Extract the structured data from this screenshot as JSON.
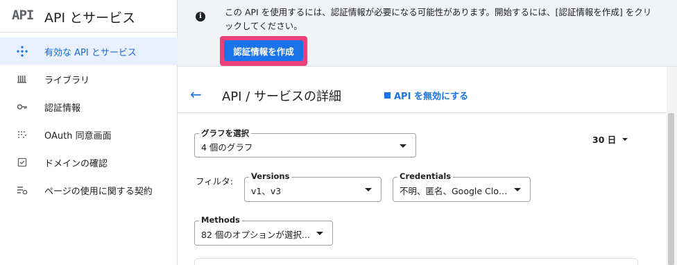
{
  "brand": {
    "logo": "API",
    "title": "API とサービス"
  },
  "sidebar": {
    "items": [
      {
        "label": "有効な API とサービス",
        "icon": "api-diamond-icon",
        "active": true
      },
      {
        "label": "ライブラリ",
        "icon": "library-icon"
      },
      {
        "label": "認証情報",
        "icon": "key-icon"
      },
      {
        "label": "OAuth 同意画面",
        "icon": "consent-icon"
      },
      {
        "label": "ドメインの確認",
        "icon": "checkbox-icon"
      },
      {
        "label": "ページの使用に関する契約",
        "icon": "settings-list-icon"
      }
    ]
  },
  "banner": {
    "info_icon": "i",
    "text": "この API を使用するには、認証情報が必要になる可能性があります。開始するには、[認証情報を作成] をクリックしてください。",
    "button_label": "認証情報を作成"
  },
  "header": {
    "back_icon": "←",
    "title": "API / サービスの詳細",
    "disable_label": "API を無効にする"
  },
  "controls": {
    "graph_select": {
      "label": "グラフを選択",
      "value": "4 個のグラフ"
    },
    "range": "30 日",
    "filter_label": "フィルタ:",
    "versions": {
      "label": "Versions",
      "value": "v1、v3"
    },
    "credentials": {
      "label": "Credentials",
      "value": "不明、匿名、Google Clou..."
    },
    "methods": {
      "label": "Methods",
      "value": "82 個のオプションが選択..."
    }
  },
  "colors": {
    "accent": "#1a73e8",
    "highlight": "#ec407a",
    "active_bg": "#e8f0fe"
  }
}
